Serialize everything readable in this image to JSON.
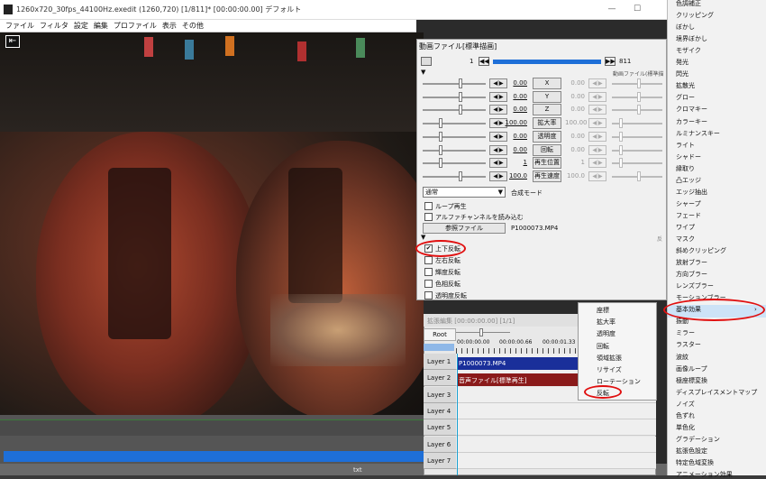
{
  "window": {
    "title": "1260x720_30fps_44100Hz.exedit (1260,720)  [1/811]* [00:00:00.00]  デフォルト",
    "min": "—",
    "max": "☐"
  },
  "menubar": [
    "ファイル",
    "フィルタ",
    "設定",
    "編集",
    "プロファイル",
    "表示",
    "その他"
  ],
  "dialog": {
    "title": "動画ファイル[標準描画]",
    "frame_start": "1",
    "frame_end": "811",
    "header_right": "動画ファイル(標準描",
    "params": [
      {
        "val": "0.00",
        "label": "X",
        "gval": "0.00"
      },
      {
        "val": "0.00",
        "label": "Y",
        "gval": "0.00"
      },
      {
        "val": "0.00",
        "label": "Z",
        "gval": "0.00"
      },
      {
        "val": "100.00",
        "label": "拡大率",
        "gval": "100.00"
      },
      {
        "val": "0.00",
        "label": "透明度",
        "gval": "0.00"
      },
      {
        "val": "0.00",
        "label": "回転",
        "gval": "0.00"
      },
      {
        "val": "1",
        "label": "再生位置",
        "gval": "1"
      },
      {
        "val": "100.0",
        "label": "再生速度",
        "gval": "100.0"
      }
    ],
    "blend_value": "通常",
    "blend_label": "合成モード",
    "loop": "ループ再生",
    "alpha": "アルファチャンネルを読み込む",
    "ref_button": "参照ファイル",
    "ref_file": "P1000073.MP4",
    "right_cut": "反",
    "flip": [
      {
        "label": "上下反転",
        "checked": "✔"
      },
      {
        "label": "左右反転",
        "checked": ""
      },
      {
        "label": "輝度反転",
        "checked": ""
      },
      {
        "label": "色相反転",
        "checked": ""
      },
      {
        "label": "透明度反転",
        "checked": ""
      }
    ]
  },
  "timeline": {
    "title": "拡張編集 [00:00:00.00] [1/1]",
    "root": "Root",
    "ticks": [
      "00:00:00.00",
      "00:00:00.66",
      "00:00:01.33"
    ],
    "layers": [
      "Layer 1",
      "Layer 2",
      "Layer 3",
      "Layer 4",
      "Layer 5",
      "Layer 6",
      "Layer 7"
    ],
    "clip1": "P1000073.MP4",
    "clip2": "音声ファイル[標準再生]"
  },
  "context_menu": [
    "座標",
    "拡大率",
    "透明度",
    "回転",
    "領域拡張",
    "リサイズ",
    "ローテーション",
    "反転"
  ],
  "right_menu": [
    "色調補正",
    "クリッピング",
    "ぼかし",
    "境界ぼかし",
    "モザイク",
    "発光",
    "閃光",
    "拡散光",
    "グロー",
    "クロマキー",
    "カラーキー",
    "ルミナンスキー",
    "ライト",
    "シャドー",
    "縁取り",
    "凸エッジ",
    "エッジ抽出",
    "シャープ",
    "フェード",
    "ワイプ",
    "マスク",
    "斜めクリッピング",
    "放射ブラー",
    "方向ブラー",
    "レンズブラー",
    "モーションブラー",
    "基本効果",
    "振動",
    "ミラー",
    "ラスター",
    "波紋",
    "画像ループ",
    "極座標変換",
    "ディスプレイスメントマップ",
    "ノイズ",
    "色ずれ",
    "単色化",
    "グラデーション",
    "拡張色設定",
    "特定色域変換",
    "アニメーション効果"
  ],
  "submenu_arrow": "›",
  "status": "txt",
  "colors": {
    "highlight": "#cde3f7",
    "oval": "#e01010",
    "clip_blue": "#1a2f9a",
    "clip_red": "#8a1a1a",
    "seek": "#1e6fd8"
  }
}
